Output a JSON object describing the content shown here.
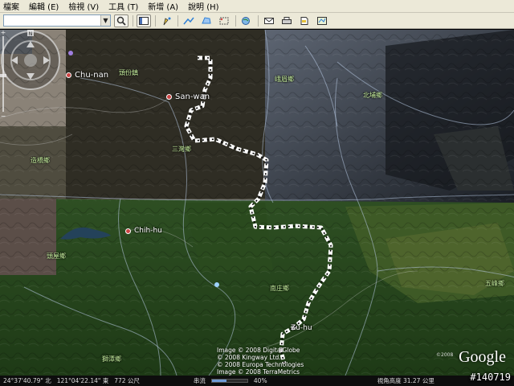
{
  "menu": [
    "檔案",
    "編輯 (E)",
    "檢視 (V)",
    "工具 (T)",
    "新增 (A)",
    "說明 (H)"
  ],
  "search": {
    "placeholder": "",
    "button_icon": "search-icon"
  },
  "toolbar_icons": [
    "sidebar-icon",
    "placemark-icon",
    "path-icon",
    "polygon-icon",
    "overlay-icon",
    "tour-icon",
    "email-icon",
    "print-icon",
    "kml-icon",
    "maps-icon"
  ],
  "places": {
    "chunan": "Chu-nan",
    "sanwan": "San-wan",
    "chihhu": "Chih-hu",
    "zuhu": "Zu-hu",
    "t1": "頭份鎮",
    "t2": "峨眉鄉",
    "t3": "北埔鄉",
    "t4": "造橋鄉",
    "t5": "三灣鄉",
    "t6": "頭屋鄉",
    "t7": "南庄鄉",
    "t8": "五峰鄉",
    "t9": "獅潭鄉"
  },
  "credits": [
    "Image © 2008 DigitalGlobe",
    "© 2008 Kingway Ltd.",
    "© 2008 Europa Technologies",
    "Image © 2008 TerraMetrics"
  ],
  "logo": {
    "text": "Google",
    "copyright": "©2008"
  },
  "status": {
    "coords": "24°37'40.79\" 北",
    "lon": "121°04'22.14\" 東",
    "elev": "772 公尺",
    "streaming_label": "串流",
    "streaming_percent": 40,
    "streaming_value": "40%",
    "eye_alt": "視角高度 31.27 公里"
  },
  "watermark": "#140719",
  "colors": {
    "route": "#ffffff",
    "border": "#b0c4de"
  }
}
